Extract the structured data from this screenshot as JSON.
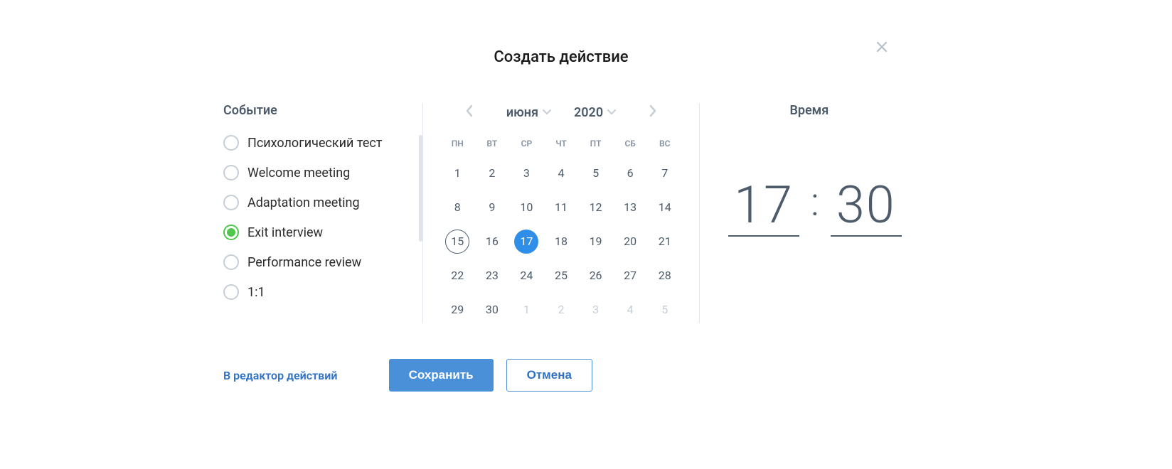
{
  "title": "Создать действие",
  "eventSection": {
    "heading": "Событие",
    "items": [
      {
        "label": "Психологический тест",
        "selected": false
      },
      {
        "label": "Welcome meeting",
        "selected": false
      },
      {
        "label": "Adaptation meeting",
        "selected": false
      },
      {
        "label": "Exit interview",
        "selected": true
      },
      {
        "label": "Performance review",
        "selected": false
      },
      {
        "label": "1:1",
        "selected": false
      }
    ]
  },
  "calendar": {
    "month": "июня",
    "year": "2020",
    "dow": [
      "ПН",
      "ВТ",
      "СР",
      "ЧТ",
      "ПТ",
      "СБ",
      "ВС"
    ],
    "cells": [
      {
        "n": "1",
        "other": false
      },
      {
        "n": "2",
        "other": false
      },
      {
        "n": "3",
        "other": false
      },
      {
        "n": "4",
        "other": false
      },
      {
        "n": "5",
        "other": false
      },
      {
        "n": "6",
        "other": false
      },
      {
        "n": "7",
        "other": false
      },
      {
        "n": "8",
        "other": false
      },
      {
        "n": "9",
        "other": false
      },
      {
        "n": "10",
        "other": false
      },
      {
        "n": "11",
        "other": false
      },
      {
        "n": "12",
        "other": false
      },
      {
        "n": "13",
        "other": false
      },
      {
        "n": "14",
        "other": false
      },
      {
        "n": "15",
        "other": false,
        "today": true
      },
      {
        "n": "16",
        "other": false
      },
      {
        "n": "17",
        "other": false,
        "selected": true
      },
      {
        "n": "18",
        "other": false
      },
      {
        "n": "19",
        "other": false
      },
      {
        "n": "20",
        "other": false
      },
      {
        "n": "21",
        "other": false
      },
      {
        "n": "22",
        "other": false
      },
      {
        "n": "23",
        "other": false
      },
      {
        "n": "24",
        "other": false
      },
      {
        "n": "25",
        "other": false
      },
      {
        "n": "26",
        "other": false
      },
      {
        "n": "27",
        "other": false
      },
      {
        "n": "28",
        "other": false
      },
      {
        "n": "29",
        "other": false
      },
      {
        "n": "30",
        "other": false
      },
      {
        "n": "1",
        "other": true
      },
      {
        "n": "2",
        "other": true
      },
      {
        "n": "3",
        "other": true
      },
      {
        "n": "4",
        "other": true
      },
      {
        "n": "5",
        "other": true
      }
    ]
  },
  "timeSection": {
    "heading": "Время",
    "hour": "17",
    "minute": "30"
  },
  "footer": {
    "editorLink": "В редактор действий",
    "save": "Сохранить",
    "cancel": "Отмена"
  }
}
